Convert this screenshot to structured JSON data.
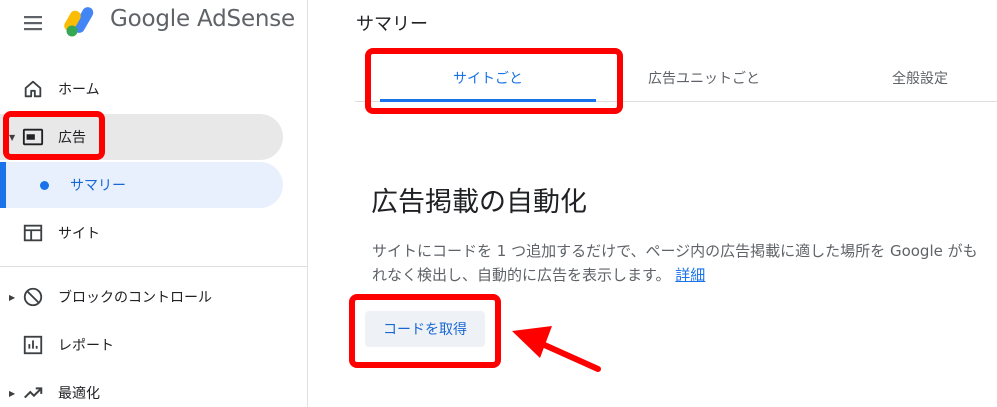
{
  "header": {
    "menu_icon": "menu-icon",
    "brand": "Google AdSense",
    "logo_colors": {
      "yellow": "#fbbc04",
      "blue": "#4285f4",
      "green": "#34a853"
    },
    "page_title": "サマリー"
  },
  "sidebar": {
    "items": [
      {
        "label": "ホーム",
        "icon": "home-icon"
      },
      {
        "label": "広告",
        "icon": "ad-unit-icon",
        "expanded": true
      },
      {
        "label": "サマリー",
        "icon": "dot-icon",
        "selected": true
      },
      {
        "label": "サイト",
        "icon": "sites-icon"
      },
      {
        "label": "ブロックのコントロール",
        "icon": "block-icon"
      },
      {
        "label": "レポート",
        "icon": "report-icon"
      },
      {
        "label": "最適化",
        "icon": "trending-up-icon"
      }
    ]
  },
  "tabs": [
    {
      "label": "サイトごと",
      "active": true
    },
    {
      "label": "広告ユニットごと",
      "active": false
    },
    {
      "label": "全般設定",
      "active": false
    }
  ],
  "main": {
    "heading": "広告掲載の自動化",
    "description": "サイトにコードを 1 つ追加するだけで、ページ内の広告掲載に適した場所を Google がもれなく検出し、自動的に広告を表示します。",
    "details_link": "詳細",
    "get_code_button": "コードを取得"
  },
  "colors": {
    "accent": "#1a73e8",
    "annotation": "#ff0000",
    "selected_bg": "#e8f0fe",
    "expanded_bg": "#e8e8e8"
  }
}
